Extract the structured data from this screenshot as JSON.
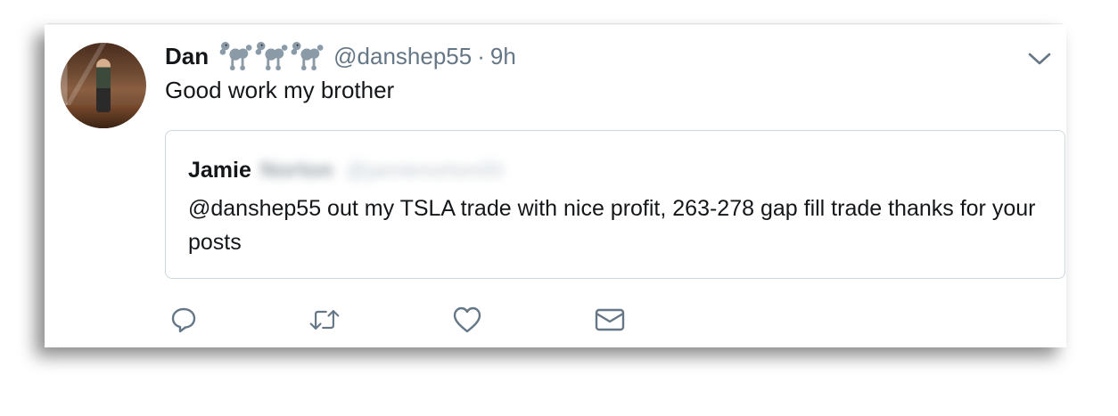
{
  "tweet": {
    "display_name": "Dan",
    "handle": "@danshep55",
    "separator": "·",
    "time": "9h",
    "text": "Good work my brother",
    "name_emojis": [
      "poodle-icon",
      "poodle-icon",
      "poodle-icon"
    ]
  },
  "quoted_tweet": {
    "display_name": "Jamie",
    "blurred_surname": "Norton",
    "blurred_handle": "@jamienorton00",
    "text": "@danshep55 out my TSLA trade with nice profit, 263-278 gap fill trade thanks for your posts"
  },
  "actions": [
    {
      "name": "reply",
      "icon": "reply-icon"
    },
    {
      "name": "retweet",
      "icon": "retweet-icon"
    },
    {
      "name": "like",
      "icon": "heart-icon"
    },
    {
      "name": "direct-message",
      "icon": "envelope-icon"
    }
  ],
  "colors": {
    "text": "#14171a",
    "secondary_text": "#657786",
    "border": "#ccd6dd"
  }
}
